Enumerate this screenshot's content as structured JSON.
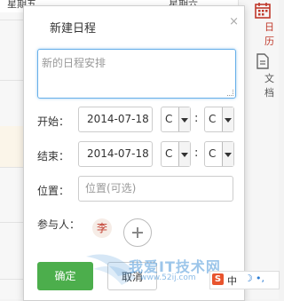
{
  "background": {
    "top_labels": [
      "星期五",
      "星期六"
    ],
    "right_nav": [
      {
        "label": "日历",
        "icon": "calendar-icon",
        "active": true
      },
      {
        "label": "文档",
        "icon": "document-icon",
        "active": false
      }
    ]
  },
  "dialog": {
    "title": "新建日程",
    "close_glyph": "×",
    "description_placeholder": "新的日程安排",
    "start": {
      "label": "开始：",
      "date": "2014-07-18",
      "hour": "C",
      "minute": "C"
    },
    "end": {
      "label": "结束：",
      "date": "2014-07-18",
      "hour": "C",
      "minute": "C"
    },
    "time_separator": ":",
    "location": {
      "label": "位置：",
      "placeholder": "位置(可选)"
    },
    "participants": {
      "label": "参与人：",
      "avatar": "李"
    },
    "confirm_label": "确定",
    "cancel_label": "取消"
  },
  "watermark": {
    "title": "我爱IT技术网",
    "url": "www.52ij.com"
  },
  "ime": {
    "logo": "S",
    "mode": "中",
    "moon": "☽",
    "dot": "•,"
  },
  "colors": {
    "accent_green": "#4cae4c",
    "active_red": "#c0392b",
    "focus_blue": "#66afe9"
  }
}
